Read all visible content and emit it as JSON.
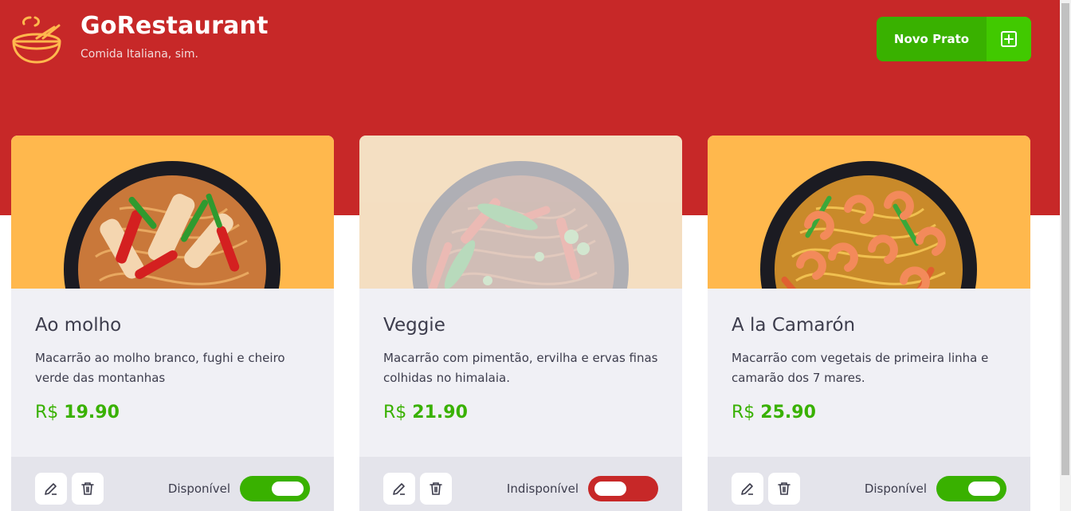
{
  "header": {
    "title": "GoRestaurant",
    "subtitle": "Comida Italiana, sim.",
    "new_button_label": "Novo Prato",
    "logo_icon": "bowl-icon",
    "plus_icon": "plus-square-icon"
  },
  "cards": [
    {
      "name": "Ao molho",
      "description": "Macarrão ao molho branco, fughi e cheiro verde das montanhas",
      "currency": "R$",
      "price": "19.90",
      "availability_label": "Disponível",
      "available": true
    },
    {
      "name": "Veggie",
      "description": "Macarrão com pimentão, ervilha e ervas finas colhidas no himalaia.",
      "currency": "R$",
      "price": "21.90",
      "availability_label": "Indisponível",
      "available": false
    },
    {
      "name": "A la Camarón",
      "description": "Macarrão com vegetais de primeira linha e camarão dos 7 mares.",
      "currency": "R$",
      "price": "25.90",
      "availability_label": "Disponível",
      "available": true
    }
  ],
  "colors": {
    "header_red": "#c72828",
    "accent_green": "#39b100",
    "card_image_bg": "#ffb84d",
    "toggle_off": "#c72828"
  }
}
